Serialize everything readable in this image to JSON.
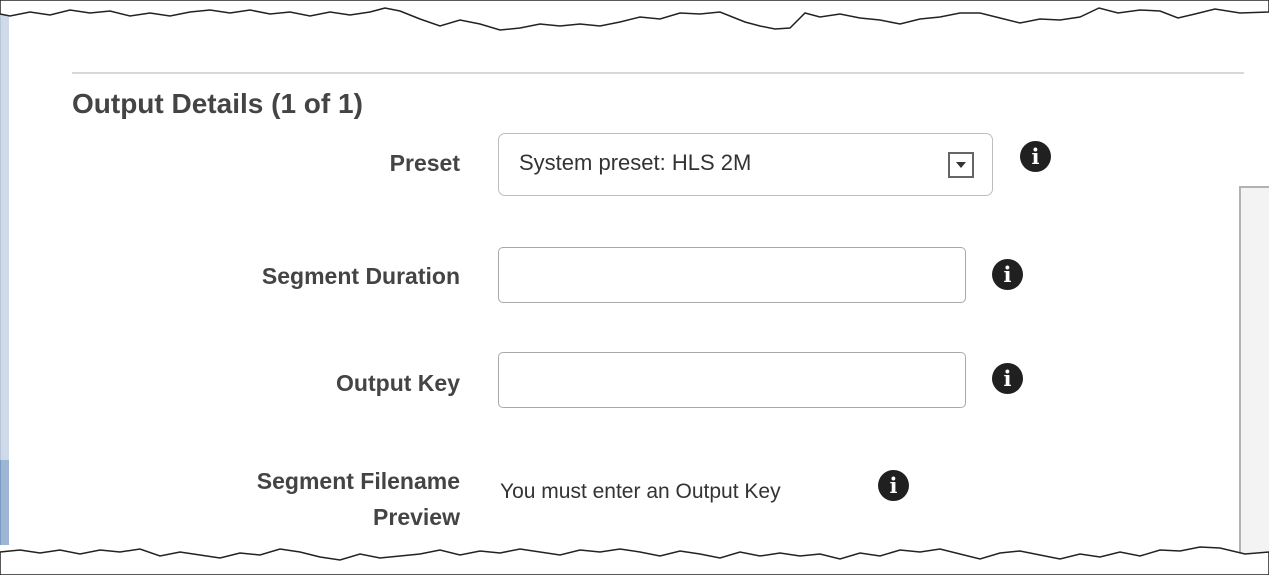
{
  "section": {
    "title": "Output Details (1 of 1)"
  },
  "fields": {
    "preset": {
      "label": "Preset",
      "value": "System preset: HLS 2M"
    },
    "segment_duration": {
      "label": "Segment Duration",
      "value": ""
    },
    "output_key": {
      "label": "Output Key",
      "value": ""
    },
    "segment_filename_preview": {
      "label_line1": "Segment Filename",
      "label_line2": "Preview",
      "value": "You must enter an Output Key"
    }
  },
  "icons": {
    "info": "info-icon",
    "dropdown": "chevron-down-icon",
    "info_glyph": "i"
  },
  "colors": {
    "label": "#444444",
    "info_icon_bg": "#202020",
    "left_border_active": "#9db6d5"
  }
}
